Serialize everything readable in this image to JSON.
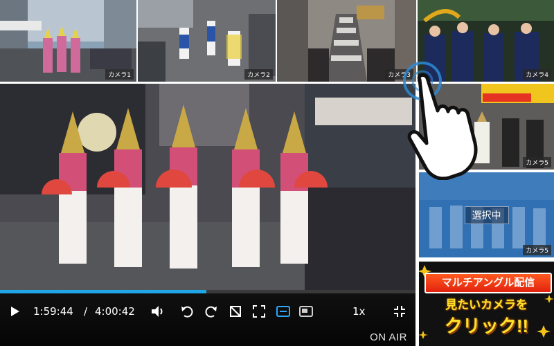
{
  "cameras": [
    {
      "label": "カメラ1"
    },
    {
      "label": "カメラ2"
    },
    {
      "label": "カメラ3"
    },
    {
      "label": "カメラ4"
    },
    {
      "label": "カメラ5"
    },
    {
      "label": "カメラ5"
    }
  ],
  "selected": {
    "badge": "選択中"
  },
  "player": {
    "current_time": "1:59:44",
    "separator": "/",
    "duration": "4:00:42",
    "speed": "1x",
    "status": "ON AIR",
    "progress_fraction": 0.497
  },
  "icons": [
    "play-icon",
    "volume-icon",
    "rewind-10-icon",
    "forward-10-icon",
    "no-subtitle-icon",
    "fullscreen-expand-icon",
    "caption-icon",
    "cast-icon",
    "exit-fullscreen-icon",
    "hand-pointer-icon"
  ],
  "promo": {
    "line1": "マルチアングル配信",
    "line2": "見たいカメラを",
    "line3": "クリック!!"
  },
  "colors": {
    "accent": "#1fa6e6",
    "promo_red": "#e2230f",
    "promo_yellow": "#ffe22a"
  }
}
